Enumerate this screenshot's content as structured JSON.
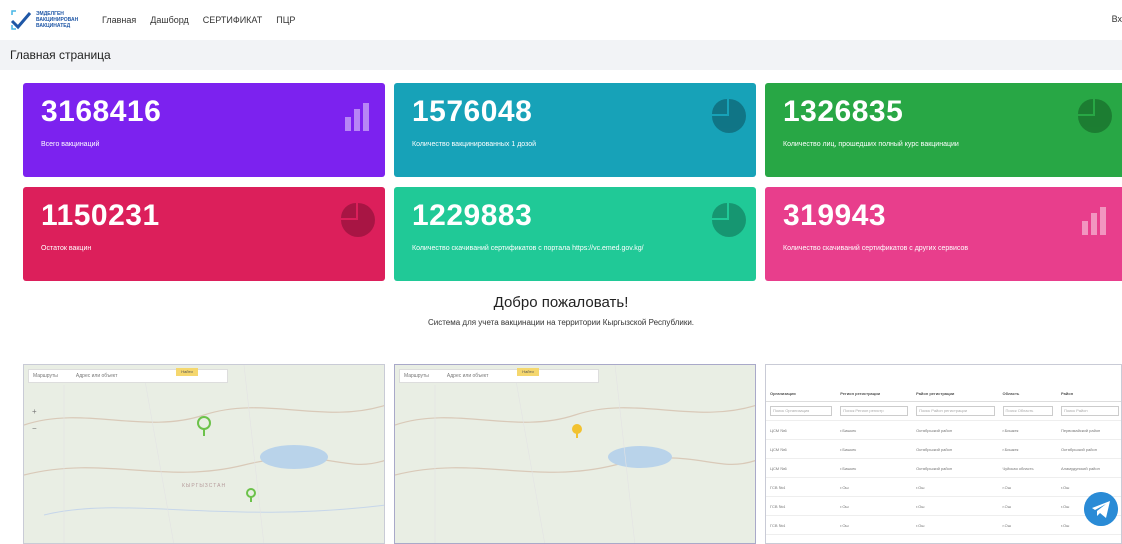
{
  "nav": {
    "logo_text": [
      "ЭМДЕЛГЕН",
      "ВАКЦИНИРОВАН",
      "ВАКЦИНАТЕД"
    ],
    "links": [
      "Главная",
      "Дашборд",
      "СЕРТИФИКАТ",
      "ПЦР"
    ],
    "right_text": "Вх"
  },
  "page": {
    "title": "Главная страница"
  },
  "cards": [
    {
      "value": "3168416",
      "label": "Всего вакцинаций",
      "color": "#7c22ef",
      "icon": "bar-chart-icon"
    },
    {
      "value": "1576048",
      "label": "Количество вакцинированных 1 дозой",
      "color": "#17a2b8",
      "icon": "pie-chart-icon"
    },
    {
      "value": "1326835",
      "label": "Количество лиц, прошедших полный курс вакцинации",
      "color": "#28a745",
      "icon": "pie-chart-icon"
    },
    {
      "value": "1150231",
      "label": "Остаток вакцин",
      "color": "#dc1f5b",
      "icon": "pie-chart-icon"
    },
    {
      "value": "1229883",
      "label": "Количество скачиваний сертификатов с портала https://vc.emed.gov.kg/",
      "color": "#20c997",
      "icon": "pie-chart-icon"
    },
    {
      "value": "319943",
      "label": "Количество скачиваний сертификатов с других сервисов",
      "color": "#e83e8c",
      "icon": "bar-chart-icon"
    }
  ],
  "welcome": {
    "title": "Добро пожаловать!",
    "subtitle": "Система для учета вакцинации на территории Кыргызской Республики."
  },
  "maps": [
    {
      "search_label": "Маршруты",
      "search_placeholder": "Адрес или объект",
      "button": "Найти",
      "region_label": "КЫРГЫЗСТАН"
    },
    {
      "search_label": "Маршруты",
      "search_placeholder": "Адрес или объект",
      "button": "Найти"
    }
  ],
  "table": {
    "columns": [
      "Организация",
      "Регион регистрации",
      "Район регистрации",
      "Область",
      "Район"
    ],
    "filters": [
      "Поиск Организация",
      "Поиск Регион регистр",
      "Поиск Район регистрации",
      "Поиск Область",
      "Поиск Район"
    ],
    "rows": [
      [
        "ЦСМ №6",
        "г.Бишкек",
        "Октябрьский район",
        "г.Бишкек",
        "Первомайский район"
      ],
      [
        "ЦСМ №6",
        "г.Бишкек",
        "Октябрьский район",
        "г.Бишкек",
        "Октябрьский район"
      ],
      [
        "ЦСМ №6",
        "г.Бишкек",
        "Октябрьский район",
        "Чуйская область",
        "Аламудунский район"
      ],
      [
        "ГСВ №4",
        "г.Ош",
        "г.Ош",
        "г.Ош",
        "г.Ош"
      ],
      [
        "ГСВ №4",
        "г.Ош",
        "г.Ош",
        "г.Ош",
        "г.Ош"
      ],
      [
        "ГСВ №4",
        "г.Ош",
        "г.Ош",
        "г.Ош",
        "г.Ош"
      ],
      [
        "ЦСМ №6",
        "г.Бишкек",
        "Октябрьский район",
        "г.Бишкек",
        "Октябрьский район"
      ]
    ]
  },
  "colors": {
    "page_header_bg": "#f2f3f6",
    "telegram": "#2a8bd6"
  }
}
